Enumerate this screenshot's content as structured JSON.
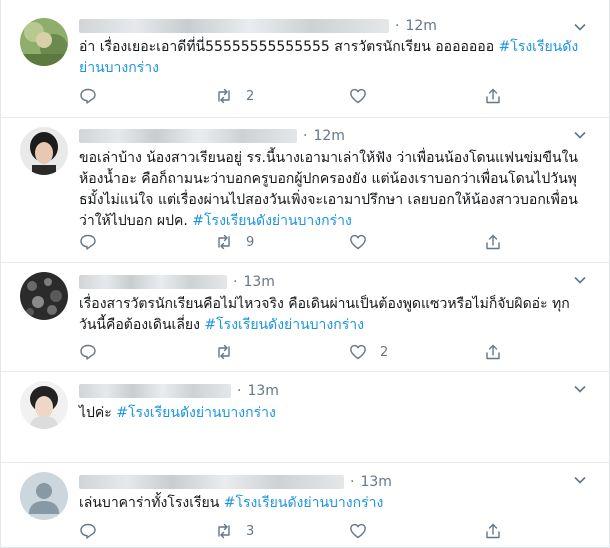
{
  "tweets": [
    {
      "time": "12m",
      "text": "อ่า เรื่องเยอะเอาดีที่นี่55555555555555 สารวัตรนักเรียน อออออออ ",
      "tag_line1": "#โรงเรียนดัง",
      "tag_line2": "ย่านบางกร่าง",
      "retweets": "2",
      "likes": ""
    },
    {
      "time": "12m",
      "lines": [
        "ขอเล่าบ้าง น้องสาวเรียนอยู่ รร.นี้นางเอามาเล่าให้ฟัง ว่าเพื่อนน้องโดนแฟนข่มขืนใน",
        "ห้องน้ำอะ คือก็ถามนะว่าบอกครูบอกผู้ปกครองยัง แต่น้องเราบอกว่าเพื่อนโดนไปวันพุ",
        "ธมั้งไม่แน่ใจ แต่เรื่องผ่านไปสองวันเพิ่งจะเอามาปรึกษา เลยบอกให้น้องสาวบอกเพื่อน"
      ],
      "last_line": "ว่าให้ไปบอก ผปค. ",
      "tag": "#โรงเรียนดังย่านบางกร่าง",
      "retweets": "9",
      "likes": ""
    },
    {
      "time": "13m",
      "line1": "เรื่องสารวัตรนักเรียนคือไม่ไหวจริง คือเดินผ่านเป็นต้องพูดแซวหรือไม่ก็จับผิดอ่ะ  ทุก",
      "line2": "วันนี้คือต้องเดินเลี่ยง  ",
      "tag": "#โรงเรียนดังย่านบางกร่าง",
      "retweets": "",
      "likes": "2"
    },
    {
      "time": "13m",
      "text": "ไปค่ะ ",
      "tag": "#โรงเรียนดังย่านบางกร่าง"
    },
    {
      "time": "13m",
      "text": "เล่นบาคาร่าทั้งโรงเรียน ",
      "tag": "#โรงเรียนดังย่านบางกร่าง",
      "retweets": "3"
    }
  ],
  "icons": [
    "reply-icon",
    "retweet-icon",
    "like-icon",
    "share-icon",
    "chevron-down-icon"
  ],
  "colors": {
    "link": "#1b95e0",
    "muted": "#657786",
    "border": "#e6ecf0"
  }
}
